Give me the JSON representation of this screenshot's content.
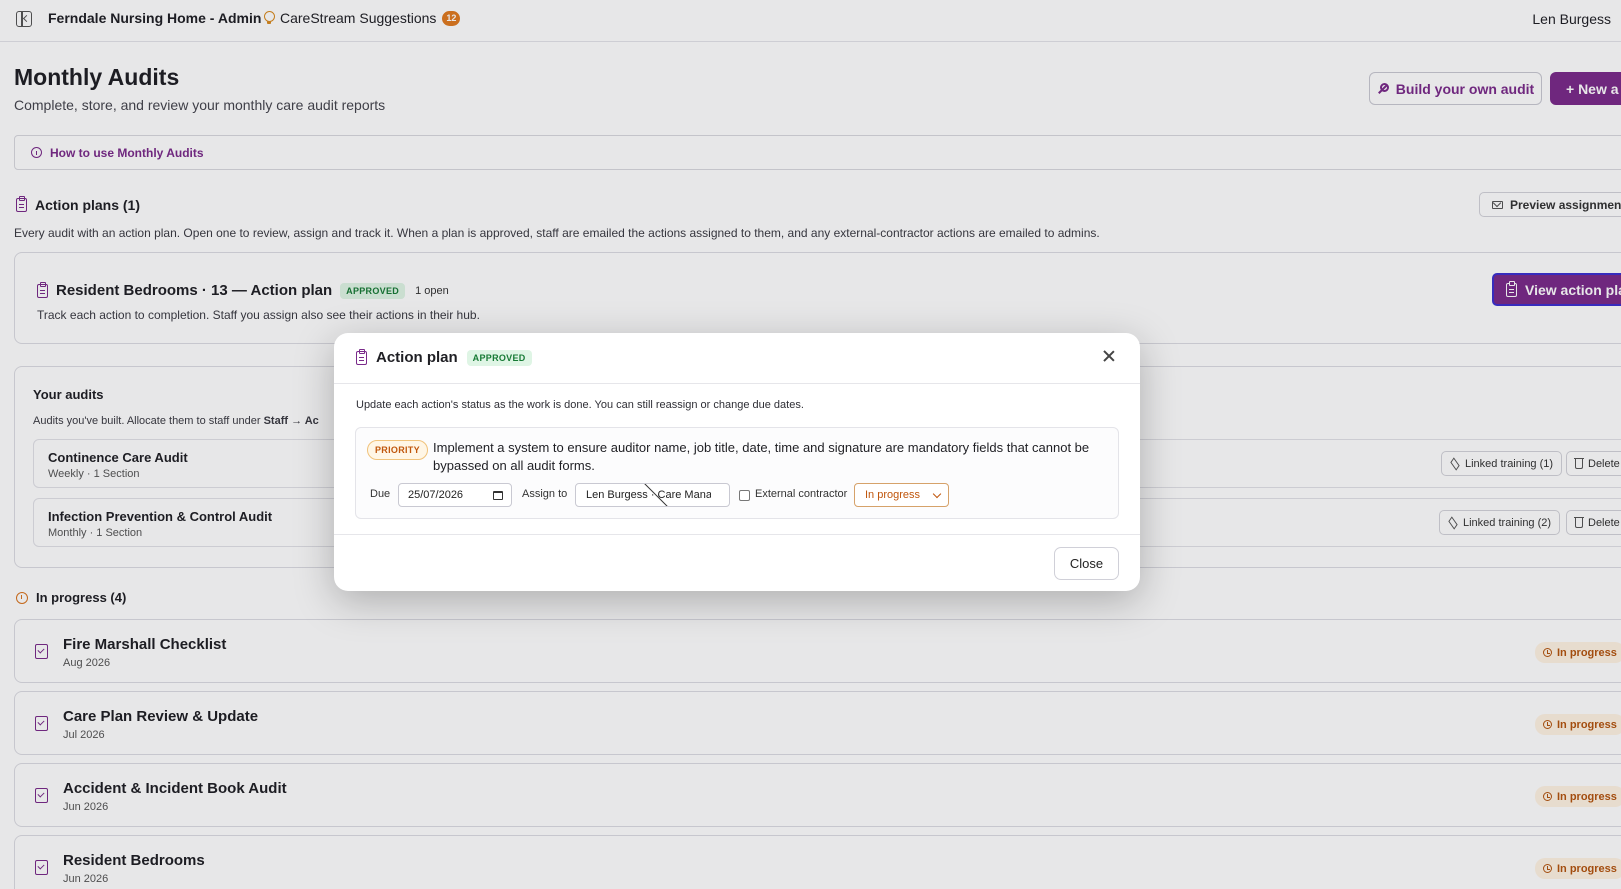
{
  "topbar": {
    "app_title": "Ferndale Nursing Home - Admin",
    "suggestions_label": "CareStream Suggestions",
    "suggestions_count": "12",
    "user_name": "Len Burgess"
  },
  "page": {
    "title": "Monthly Audits",
    "subtitle": "Complete, store, and review your monthly care audit reports",
    "build_button": "Build your own audit",
    "new_button": "+ New a",
    "howto_link": "How to use Monthly Audits"
  },
  "action_plans": {
    "heading": "Action plans (1)",
    "description": "Every audit with an action plan. Open one to review, assign and track it. When a plan is approved, staff are emailed the actions assigned to them, and any external-contractor actions are emailed to admins.",
    "preview_button": "Preview assignment e",
    "card": {
      "title": "Resident Bedrooms · 13 — Action plan",
      "status": "APPROVED",
      "open_count": "1 open",
      "description": "Track each action to completion. Staff you assign also see their actions in their hub.",
      "view_button": "View action plar"
    }
  },
  "your_audits": {
    "title": "Your audits",
    "description_start": "Audits you've built. Allocate them to staff under ",
    "description_bold": "Staff → Ac",
    "items": [
      {
        "name": "Continence Care Audit",
        "meta": "Weekly · 1 Section",
        "linked": "Linked training (1)",
        "delete": "Delete"
      },
      {
        "name": "Infection Prevention & Control Audit",
        "meta": "Monthly · 1 Section",
        "linked": "Linked training (2)",
        "delete": "Delete"
      }
    ]
  },
  "in_progress": {
    "heading": "In progress (4)",
    "items": [
      {
        "name": "Fire Marshall Checklist",
        "date": "Aug 2026",
        "status": "In progress"
      },
      {
        "name": "Care Plan Review & Update",
        "date": "Jul 2026",
        "status": "In progress"
      },
      {
        "name": "Accident & Incident Book Audit",
        "date": "Jun 2026",
        "status": "In progress"
      },
      {
        "name": "Resident Bedrooms",
        "date": "Jun 2026",
        "status": "In progress"
      }
    ]
  },
  "modal": {
    "title": "Action plan",
    "status": "APPROVED",
    "description": "Update each action's status as the work is done. You can still reassign or change due dates.",
    "action": {
      "priority": "PRIORITY",
      "text": "Implement a system to ensure auditor name, job title, date, time and signature are mandatory fields that cannot be bypassed on all audit forms.",
      "due_label": "Due",
      "due_value": "25/07/2026",
      "assign_label": "Assign to",
      "assign_value": "Len Burgess · Care Manager",
      "external_label": "External contractor",
      "external_checked": false,
      "status_value": "In progress"
    },
    "close_button": "Close"
  },
  "colors": {
    "brand": "#7a2a8a",
    "approved_bg": "#dff5e5",
    "approved_text": "#177a35",
    "in_progress_text": "#b4540e",
    "priority_text": "#c0560c"
  }
}
